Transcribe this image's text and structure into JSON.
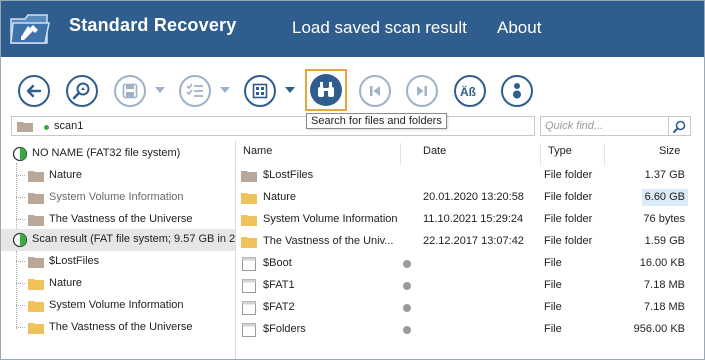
{
  "app": {
    "title": "Standard Recovery",
    "menu": [
      "Load saved scan result",
      "About"
    ]
  },
  "toolbar": {
    "buttons": [
      {
        "name": "back-icon",
        "enabled": true
      },
      {
        "name": "inspect-icon",
        "enabled": true
      },
      {
        "name": "save-icon",
        "enabled": false
      },
      {
        "name": "list-select-icon",
        "enabled": false
      },
      {
        "name": "view-grid-icon",
        "enabled": true
      },
      {
        "name": "binoculars-icon",
        "enabled": true,
        "active": true
      },
      {
        "name": "previous-icon",
        "enabled": false
      },
      {
        "name": "next-icon",
        "enabled": false
      },
      {
        "name": "case-sensitive-icon",
        "enabled": true
      },
      {
        "name": "info-icon",
        "enabled": true
      }
    ],
    "tooltip": "Search for files and folders"
  },
  "pathbar": {
    "path": "scan1",
    "search_placeholder": "Quick find..."
  },
  "tree": {
    "items": [
      {
        "label": "NO NAME (FAT32 file system)",
        "icon": "disk-icon"
      },
      {
        "label": "Nature",
        "icon": "folder-icon"
      },
      {
        "label": "System Volume Information",
        "icon": "folder-icon",
        "dim": true
      },
      {
        "label": "The Vastness of the Universe",
        "icon": "folder-icon"
      },
      {
        "label": "Scan result (FAT file system; 9.57 GB in 2",
        "icon": "disk-icon",
        "selected": true
      },
      {
        "label": "$LostFiles",
        "icon": "folder-icon"
      },
      {
        "label": "Nature",
        "icon": "folder-icon"
      },
      {
        "label": "System Volume Information",
        "icon": "folder-icon"
      },
      {
        "label": "The Vastness of the Universe",
        "icon": "folder-icon"
      }
    ]
  },
  "list": {
    "columns": {
      "name": "Name",
      "date": "Date",
      "type": "Type",
      "size": "Size"
    },
    "rows": [
      {
        "name": "$LostFiles",
        "date": "",
        "type": "File folder",
        "size": "1.37 GB",
        "icon": "folder-gray-icon"
      },
      {
        "name": "Nature",
        "date": "20.01.2020 13:20:58",
        "type": "File folder",
        "size": "6.60 GB",
        "icon": "folder-icon"
      },
      {
        "name": "System Volume Information",
        "date": "11.10.2021 15:29:24",
        "type": "File folder",
        "size": "76 bytes",
        "icon": "folder-icon"
      },
      {
        "name": "The Vastness of the Univ...",
        "date": "22.12.2017 13:07:42",
        "type": "File folder",
        "size": "1.59 GB",
        "icon": "folder-icon"
      },
      {
        "name": "$Boot",
        "date": "",
        "type": "File",
        "size": "16.00 KB",
        "icon": "file-icon"
      },
      {
        "name": "$FAT1",
        "date": "",
        "type": "File",
        "size": "7.18 MB",
        "icon": "file-icon"
      },
      {
        "name": "$FAT2",
        "date": "",
        "type": "File",
        "size": "7.18 MB",
        "icon": "file-icon"
      },
      {
        "name": "$Folders",
        "date": "",
        "type": "File",
        "size": "956.00 KB",
        "icon": "file-icon"
      }
    ]
  },
  "colors": {
    "header": "#2f5d8e",
    "accent": "#2f5d8e",
    "highlight": "#e8a73a",
    "folder": "#f1c15a",
    "folder_gray": "#b9a89a"
  }
}
